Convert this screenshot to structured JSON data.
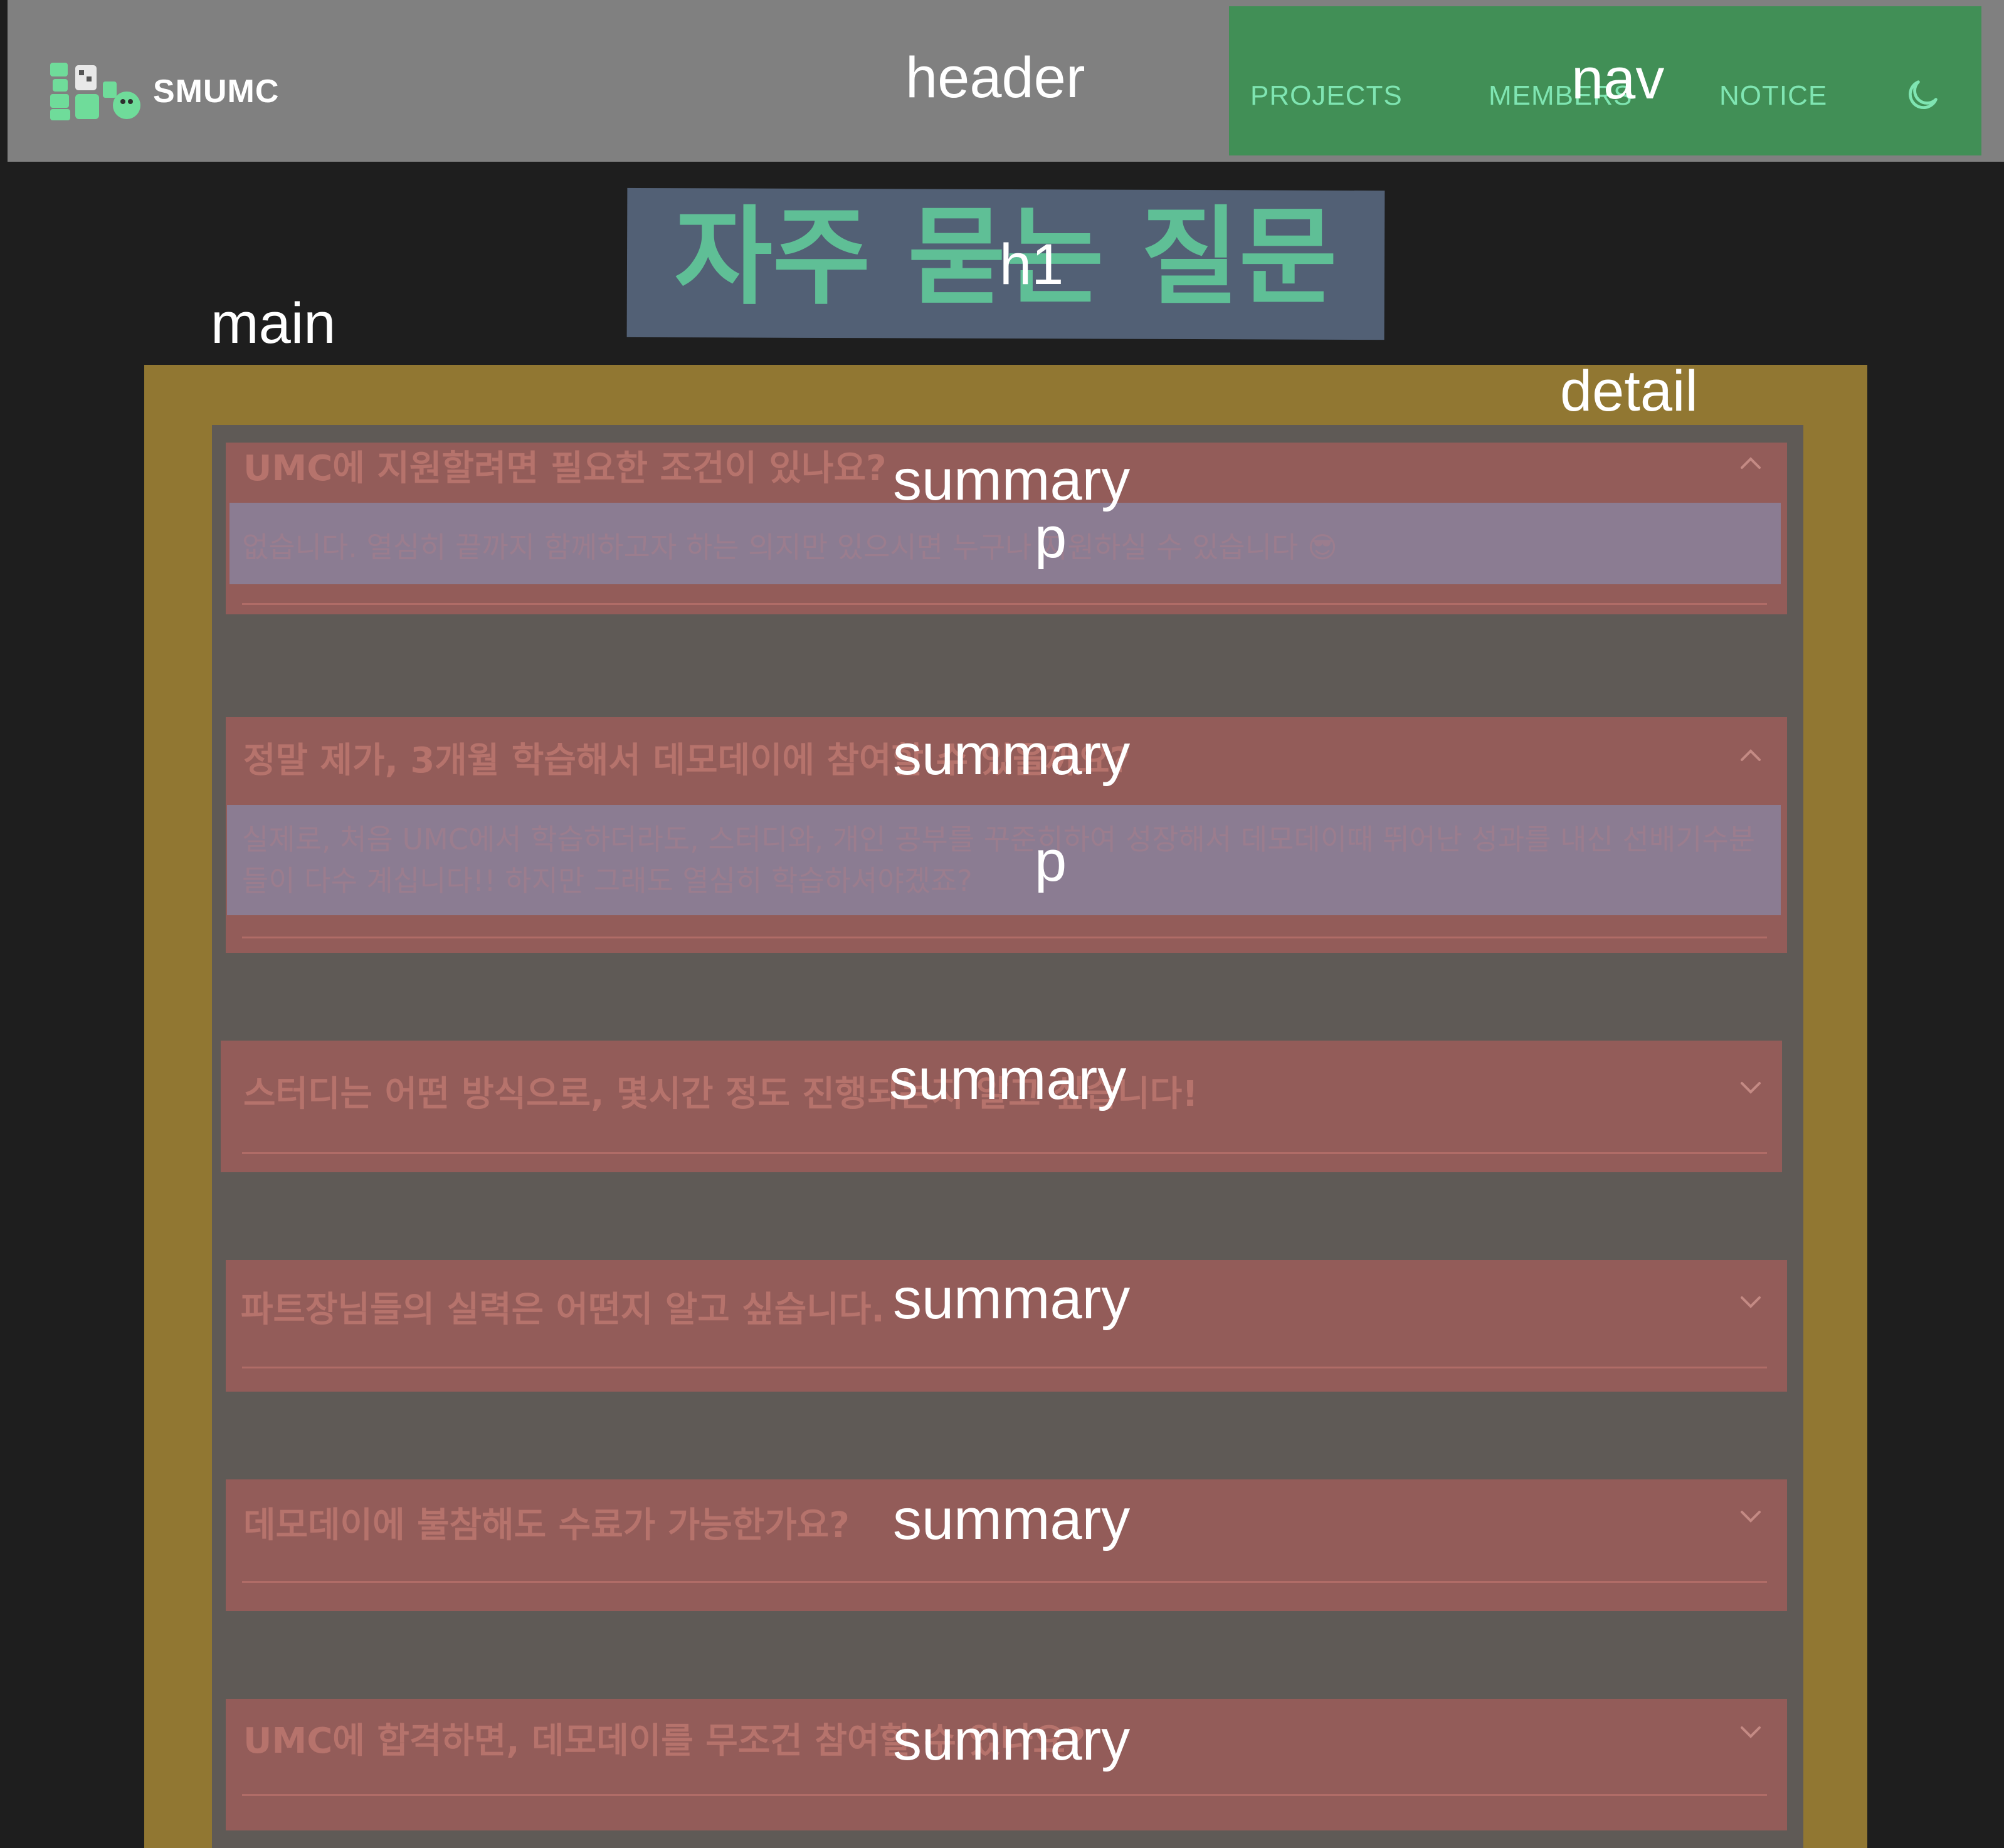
{
  "header": {
    "brand": "SMUMC",
    "label": "header"
  },
  "nav": {
    "label": "nav",
    "items": [
      "PROJECTS",
      "MEMBERS",
      "NOTICE"
    ],
    "theme_icon": "moon-icon"
  },
  "main": {
    "label": "main",
    "title": "자주 묻는 질문",
    "title_label": "h1",
    "detail_label": "detail"
  },
  "faq": [
    {
      "question": "UMC에 지원할려면 필요한 조건이 있나요?",
      "answer": "없습니다. 열심히 끝까지 함께하고자 하는 의지만 있으시면 누구나 지원하실 수 있습니다 😎",
      "expanded": true,
      "summary_label": "summary",
      "p_label": "p"
    },
    {
      "question": "정말 제가, 3개월 학습해서 데모데이에 참여할 수 있을까요?",
      "answer": "실제로, 처음 UMC에서 학습하더라도, 스터디와, 개인 공부를 꾸준히하여 성장해서 데모데이때 뛰어난 성과를 내신 선배기수분들이 다수 계십니다!! 하지만 그래도 열심히 학습하셔야겠죠?",
      "expanded": true,
      "summary_label": "summary",
      "p_label": "p"
    },
    {
      "question": "스터디는 어떤 방식으로, 몇시간 정도 진행되는지 알고 싶습니다!",
      "expanded": false,
      "summary_label": "summary"
    },
    {
      "question": "파트장님들의 실력은 어떤지 알고 싶습니다.",
      "expanded": false,
      "summary_label": "summary"
    },
    {
      "question": "데모데이에 불참해도 수료가 가능한가요?",
      "expanded": false,
      "summary_label": "summary"
    },
    {
      "question": "UMC에 합격하면, 데모데이를 무조건 참여할 수 있나요?",
      "expanded": false,
      "summary_label": "summary"
    }
  ],
  "colors": {
    "header_bg": "#808080",
    "nav_bg": "#418f56",
    "nav_text": "#7fe5b2",
    "title_box": "#526075",
    "title_text": "#5fbf96",
    "detail_outer": "#917732",
    "detail_inner": "#5f5a56",
    "summary_bg": "#935c59",
    "p_bg": "#8b7c92",
    "page_bg": "#1e1e1e"
  }
}
